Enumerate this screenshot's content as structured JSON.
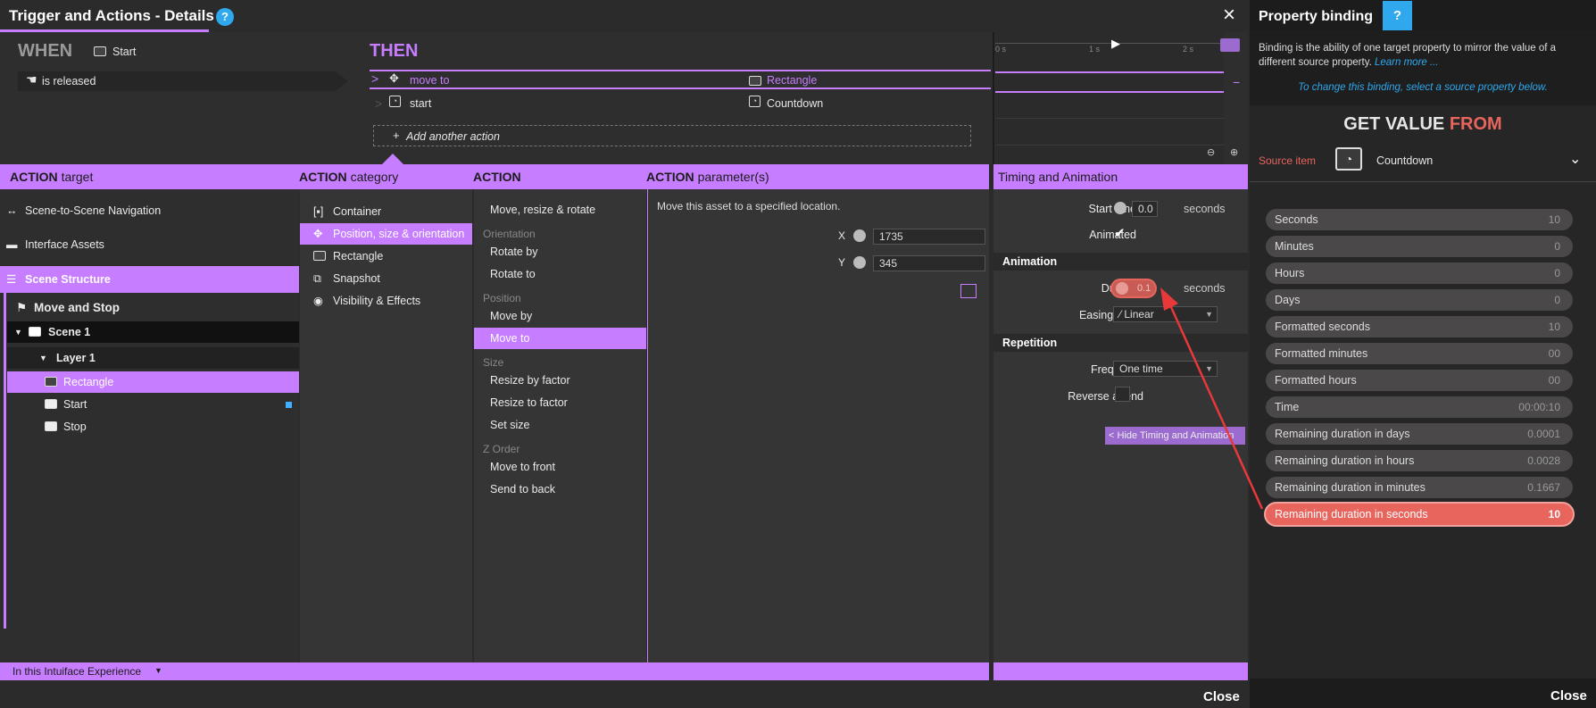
{
  "window": {
    "title": "Trigger and Actions - Details",
    "help": "?",
    "close_x": "×",
    "close_label": "Close"
  },
  "when": {
    "heading": "WHEN",
    "source": "Start",
    "trigger": "is released"
  },
  "then": {
    "heading": "THEN",
    "actions": [
      {
        "name": "move to",
        "target": "Rectangle"
      },
      {
        "name": "start",
        "target": "Countdown"
      }
    ],
    "add_action": "Add another action"
  },
  "timeline": {
    "ticks": [
      "0 s",
      "1 s",
      "2 s"
    ]
  },
  "headers": {
    "target": {
      "bold": "ACTION",
      "rest": "target"
    },
    "category": {
      "bold": "ACTION",
      "rest": "category"
    },
    "action": {
      "bold": "ACTION",
      "rest": ""
    },
    "params": {
      "bold": "ACTION",
      "rest": "parameter(s)"
    },
    "timing": "Timing and Animation"
  },
  "targets": {
    "nav": "Scene-to-Scene Navigation",
    "interface": "Interface Assets",
    "scene_structure": "Scene Structure",
    "project": "Move and Stop",
    "scene": "Scene 1",
    "layer": "Layer 1",
    "items": [
      "Rectangle",
      "Start",
      "Stop"
    ]
  },
  "categories": [
    "Container",
    "Position, size & orientation",
    "Rectangle",
    "Snapshot",
    "Visibility & Effects"
  ],
  "actions_list": {
    "top": "Move, resize & rotate",
    "groups": [
      {
        "label": "Orientation",
        "items": [
          "Rotate by",
          "Rotate to"
        ]
      },
      {
        "label": "Position",
        "items": [
          "Move by",
          "Move to"
        ]
      },
      {
        "label": "Size",
        "items": [
          "Resize by factor",
          "Resize to factor",
          "Set size"
        ]
      },
      {
        "label": "Z Order",
        "items": [
          "Move to front",
          "Send to back"
        ]
      }
    ]
  },
  "params": {
    "description": "Move this asset to a specified location.",
    "x_label": "X",
    "x_value": "1735",
    "y_label": "Y",
    "y_value": "345"
  },
  "timing": {
    "start_time_label": "Start time",
    "start_time_value": "0.0",
    "seconds": "seconds",
    "animated_label": "Animated",
    "animation_section": "Animation",
    "duration_label": "Duration",
    "duration_value": "0.1",
    "easing_label": "Easing effect",
    "easing_value": "Linear",
    "repetition_section": "Repetition",
    "frequency_label": "Frequency",
    "frequency_value": "One time",
    "reverse_label": "Reverse at end",
    "hide_button": "Hide Timing and Animation"
  },
  "footer": {
    "scope": "In this Intuiface Experience"
  },
  "binding": {
    "title": "Property binding",
    "help": "?",
    "desc": "Binding is the ability of one target property to mirror the value of a different source property.",
    "learn_more": "Learn more ...",
    "instruction": "To change this binding, select a source property below.",
    "get_value": "GET VALUE",
    "from": "FROM",
    "source_item_label": "Source item",
    "source_item_value": "Countdown",
    "properties": [
      {
        "name": "Seconds",
        "value": "10"
      },
      {
        "name": "Minutes",
        "value": "0"
      },
      {
        "name": "Hours",
        "value": "0"
      },
      {
        "name": "Days",
        "value": "0"
      },
      {
        "name": "Formatted seconds",
        "value": "10"
      },
      {
        "name": "Formatted minutes",
        "value": "00"
      },
      {
        "name": "Formatted hours",
        "value": "00"
      },
      {
        "name": "Time",
        "value": "00:00:10"
      },
      {
        "name": "Remaining duration in days",
        "value": "0.0001"
      },
      {
        "name": "Remaining duration in hours",
        "value": "0.0028"
      },
      {
        "name": "Remaining duration in minutes",
        "value": "0.1667"
      },
      {
        "name": "Remaining duration in seconds",
        "value": "10"
      }
    ],
    "close_label": "Close"
  },
  "colors": {
    "accent": "#c77dff",
    "highlight": "#e8655e",
    "help": "#2fa8ee"
  }
}
